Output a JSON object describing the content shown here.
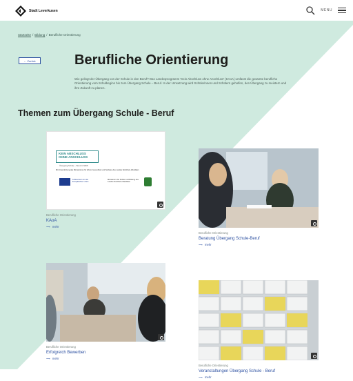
{
  "header": {
    "site_name": "Stadt Leverkusen",
    "menu_label": "MENU"
  },
  "breadcrumb": [
    "Startseite",
    "Bildung",
    "Berufliche Orientierung"
  ],
  "back_button": {
    "label": "← Zurück"
  },
  "page": {
    "title": "Berufliche Orientierung",
    "intro": "Wie gelingt der Übergang von der Schule in den Beruf? Das Landesprogramm 'Kein Abschluss ohne Anschluss' (KAoA) umfasst die gesamte berufliche Orientierung vom Schulbeginn bis zum Übergang Schule – Beruf. In der Umsetzung wird Schülerinnen und Schülern geholfen, den Übergang zu meistern und ihre Zukunft zu planen."
  },
  "section": {
    "title": "Themen zum Übergang Schule - Beruf"
  },
  "kaoa_banner": {
    "logo_line1": "KEIN ABSCHLUSS",
    "logo_line2": "OHNE ANSCHLUSS",
    "logo_sub": "Übergang Schule – Beruf in NRW",
    "caption": "Mit Unterstützung des Ministeriums für Arbeit, Gesundheit und Soziales des Landes Nordrhein-Westfalen",
    "eu_text": "Kofinanziert von der Europäischen Union",
    "ministry_text": "Ministerium für Schule und Bildung des Landes Nordrhein-Westfalen"
  },
  "cards": [
    {
      "category": "Berufliche Orientierung",
      "title": "KAoA",
      "more": "mehr"
    },
    {
      "category": "Berufliche Orientierung",
      "title": "Beratung Übergang Schule-Beruf",
      "more": "mehr"
    },
    {
      "category": "Berufliche Orientierung",
      "title": "Erfolgreich Bewerben",
      "more": "mehr"
    },
    {
      "category": "Berufliche Orientierung",
      "title": "Veranstaltungen Übergang Schule - Beruf",
      "more": "mehr"
    }
  ],
  "colors": {
    "mint": "#cfeadf",
    "link_blue": "#2b4fa0",
    "text_dark": "#1d1d1b"
  },
  "icons": [
    "city-logo-icon",
    "search-icon",
    "menu-icon",
    "arrow-right-icon",
    "zoom-icon"
  ]
}
